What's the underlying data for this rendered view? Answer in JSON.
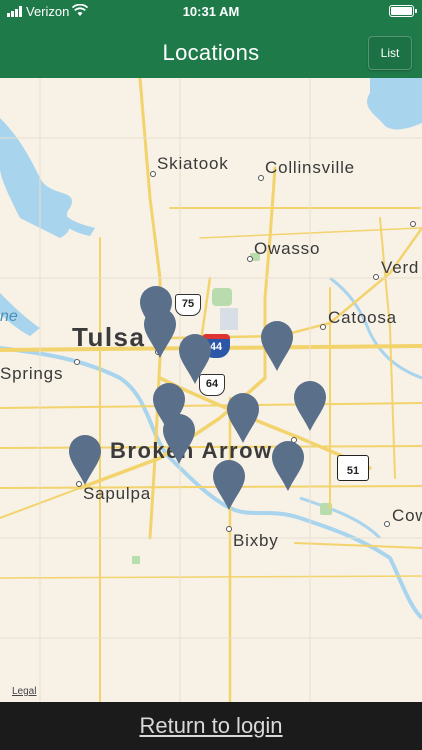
{
  "status": {
    "carrier": "Verizon",
    "time": "10:31 AM"
  },
  "header": {
    "title": "Locations",
    "list_label": "List"
  },
  "map": {
    "places": {
      "skiatook": "Skiatook",
      "collinsville": "Collinsville",
      "owasso": "Owasso",
      "verdigris": "Verd",
      "catoosa": "Catoosa",
      "tulsa": "Tulsa",
      "sand_springs": "Springs",
      "broken_arrow": "Broken Arrow",
      "sapulpa": "Sapulpa",
      "bixby": "Bixby",
      "coweta": "Cow",
      "lake": "ne"
    },
    "routes": {
      "us75": "75",
      "i44": "44",
      "us64": "64",
      "ok51": "51"
    },
    "legal": "Legal",
    "pin_count": 14,
    "pin_color": "#5a6f8a",
    "road_color": "#f3d36b",
    "water_color": "#a8d4ee",
    "park_color": "#b9dcae"
  },
  "footer": {
    "return_label": "Return to login"
  }
}
